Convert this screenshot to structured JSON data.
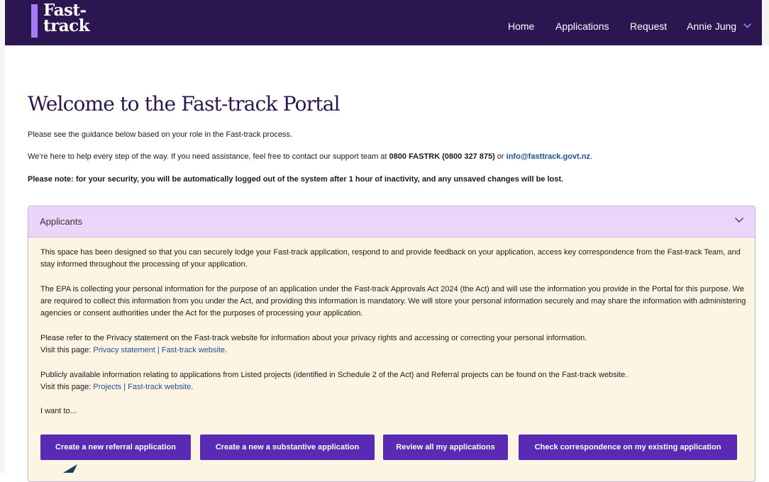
{
  "header": {
    "logo_line1": "Fast-",
    "logo_line2": "track",
    "nav": {
      "home": "Home",
      "applications": "Applications",
      "request": "Request",
      "user": "Annie Jung"
    }
  },
  "page": {
    "title": "Welcome to the Fast-track Portal",
    "intro_line1": "Please see the guidance below based on your role in the Fast-track process.",
    "intro_line2_pre": "We’re here to help every step of the way. If you need assistance, feel free to contact our support team at ",
    "phone": "0800 FASTRK (0800 327 875)",
    "intro_line2_mid": " or ",
    "email": "info@fasttrack.govt.nz",
    "intro_line2_post": ".",
    "security_note": "Please note: for your security, you will be automatically logged out of the system after 1 hour of inactivity, and any unsaved changes will be lost."
  },
  "applicants": {
    "title": "Applicants",
    "p1": "This space has been designed so that you can securely lodge your Fast-track application, respond to and provide feedback on your application, access key correspondence from the Fast-track Team, and stay informed throughout the processing of your application.",
    "p2": "The EPA is collecting your personal information for the purpose of an application under the Fast-track Approvals Act 2024 (the Act) and will use the information you provide in the Portal for this purpose. We are required to collect this information from you under the Act, and providing this information is mandatory. We will store your personal information securely and may share the information with administering agencies or consent authorities under the Act for the purposes of processing your application.",
    "p3_line1": "Please refer to the Privacy statement on the Fast-track website for information about your privacy rights and accessing or correcting your personal information.",
    "p3_visit": "Visit this page: ",
    "p3_link": "Privacy statement | Fast-track website",
    "p3_end": ".",
    "p4_line1": "Publicly available information relating to applications from Listed projects (identified in Schedule 2 of the Act) and Referral projects can be found on the Fast-track website.",
    "p4_visit": "Visit this page: ",
    "p4_link": "Projects | Fast-track website",
    "p4_end": ".",
    "i_want_to": "I want to...",
    "buttons": {
      "referral": "Create a new referral application",
      "substantive": "Create a new a substantive application",
      "review": "Review all my applications",
      "correspondence": "Check correspondence on my existing application"
    }
  },
  "colors": {
    "header_bg": "#2b1652",
    "accent": "#a67cf2",
    "button_bg": "#5b2ab4",
    "panel_head_bg": "#ead5fb",
    "panel_body_bg": "#fdf5e3",
    "link": "#1f4e9c"
  }
}
